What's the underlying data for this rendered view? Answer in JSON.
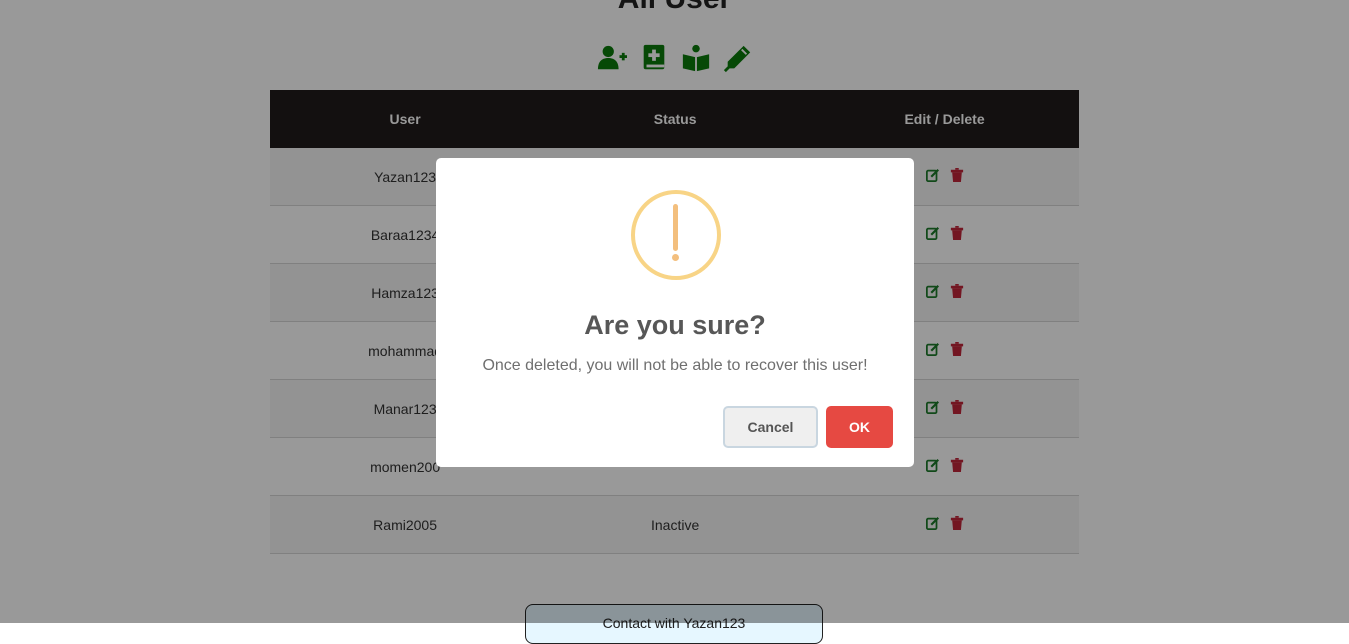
{
  "page": {
    "title": "All User"
  },
  "toolbar": {
    "icons": [
      "add-user-icon",
      "add-book-icon",
      "book-open-icon",
      "pen-icon"
    ],
    "icon_color": "#0a7a0a"
  },
  "table": {
    "headers": {
      "user": "User",
      "status": "Status",
      "actions": "Edit / Delete"
    },
    "rows": [
      {
        "user": "Yazan123",
        "status": ""
      },
      {
        "user": "Baraa1234",
        "status": ""
      },
      {
        "user": "Hamza123",
        "status": ""
      },
      {
        "user": "mohammad",
        "status": ""
      },
      {
        "user": "Manar123",
        "status": ""
      },
      {
        "user": "momen200",
        "status": ""
      },
      {
        "user": "Rami2005",
        "status": "Inactive"
      }
    ],
    "edit_icon_color": "#1d7a2a",
    "delete_icon_color": "#c0263a"
  },
  "footer": {
    "contact_label": "Contact with Yazan123"
  },
  "modal": {
    "icon": "warning-icon",
    "title": "Are you sure?",
    "text": "Once deleted, you will not be able to recover this user!",
    "cancel_label": "Cancel",
    "ok_label": "OK",
    "ok_color": "#e64942"
  }
}
